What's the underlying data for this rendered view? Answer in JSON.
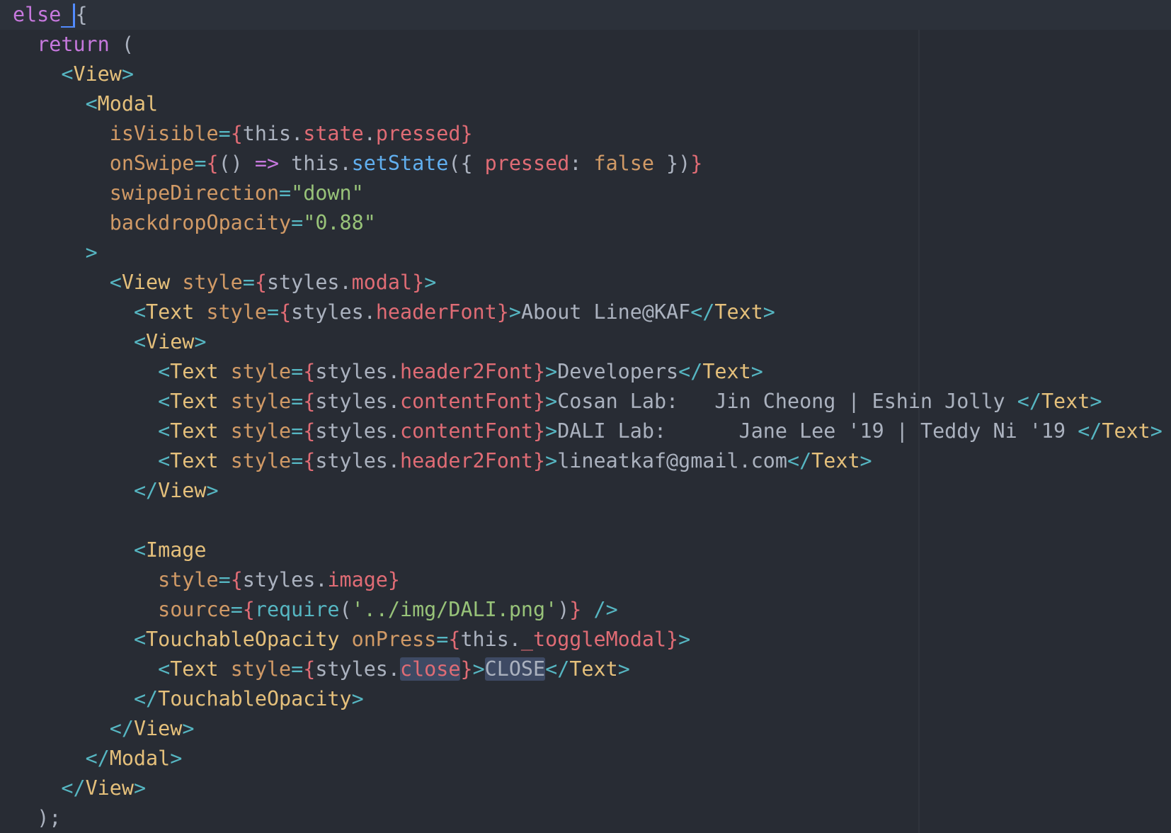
{
  "editor": {
    "cursor_line": 0,
    "highlight_tokens": [
      "close",
      "CLOSE"
    ],
    "colors": {
      "background": "#282c34",
      "cursor_line": "#2c313a",
      "keyword": "#c678dd",
      "tag": "#e5c07b",
      "bracket": "#56b6c2",
      "attribute": "#d19a66",
      "brace": "#e06c75",
      "property": "#e06c75",
      "string": "#98c379",
      "function": "#61afef",
      "text": "#abb2bf",
      "caret": "#528bff",
      "selection_highlight": "#3e4a64"
    },
    "lines": [
      {
        "indent": 0,
        "tokens": [
          [
            "keyword",
            "else"
          ],
          [
            "default",
            " "
          ],
          [
            "punct",
            "{"
          ]
        ],
        "caret_after": 2
      },
      {
        "indent": 1,
        "tokens": [
          [
            "keyword",
            "return"
          ],
          [
            "default",
            " ("
          ]
        ]
      },
      {
        "indent": 2,
        "tokens": [
          [
            "bracket",
            "<"
          ],
          [
            "tag",
            "View"
          ],
          [
            "bracket",
            ">"
          ]
        ]
      },
      {
        "indent": 3,
        "tokens": [
          [
            "bracket",
            "<"
          ],
          [
            "tag",
            "Modal"
          ]
        ]
      },
      {
        "indent": 4,
        "tokens": [
          [
            "attr",
            "isVisible"
          ],
          [
            "bracket",
            "="
          ],
          [
            "brace",
            "{"
          ],
          [
            "this",
            "this"
          ],
          [
            "punct",
            "."
          ],
          [
            "prop",
            "state"
          ],
          [
            "punct",
            "."
          ],
          [
            "prop",
            "pressed"
          ],
          [
            "brace",
            "}"
          ]
        ]
      },
      {
        "indent": 4,
        "tokens": [
          [
            "attr",
            "onSwipe"
          ],
          [
            "bracket",
            "="
          ],
          [
            "brace",
            "{"
          ],
          [
            "punct",
            "() "
          ],
          [
            "operator",
            "=>"
          ],
          [
            "default",
            " "
          ],
          [
            "this",
            "this"
          ],
          [
            "punct",
            "."
          ],
          [
            "func",
            "setState"
          ],
          [
            "punct",
            "({ "
          ],
          [
            "prop",
            "pressed"
          ],
          [
            "punct",
            ": "
          ],
          [
            "bool",
            "false"
          ],
          [
            "punct",
            " })"
          ],
          [
            "brace",
            "}"
          ]
        ]
      },
      {
        "indent": 4,
        "tokens": [
          [
            "attr",
            "swipeDirection"
          ],
          [
            "bracket",
            "="
          ],
          [
            "string",
            "\"down\""
          ]
        ]
      },
      {
        "indent": 4,
        "tokens": [
          [
            "attr",
            "backdropOpacity"
          ],
          [
            "bracket",
            "="
          ],
          [
            "string",
            "\"0.88\""
          ]
        ]
      },
      {
        "indent": 3,
        "tokens": [
          [
            "bracket",
            ">"
          ]
        ]
      },
      {
        "indent": 4,
        "tokens": [
          [
            "bracket",
            "<"
          ],
          [
            "tag",
            "View"
          ],
          [
            "default",
            " "
          ],
          [
            "attr",
            "style"
          ],
          [
            "bracket",
            "="
          ],
          [
            "brace",
            "{"
          ],
          [
            "default",
            "styles"
          ],
          [
            "punct",
            "."
          ],
          [
            "prop",
            "modal"
          ],
          [
            "brace",
            "}"
          ],
          [
            "bracket",
            ">"
          ]
        ]
      },
      {
        "indent": 5,
        "tokens": [
          [
            "bracket",
            "<"
          ],
          [
            "tag",
            "Text"
          ],
          [
            "default",
            " "
          ],
          [
            "attr",
            "style"
          ],
          [
            "bracket",
            "="
          ],
          [
            "brace",
            "{"
          ],
          [
            "default",
            "styles"
          ],
          [
            "punct",
            "."
          ],
          [
            "prop",
            "headerFont"
          ],
          [
            "brace",
            "}"
          ],
          [
            "bracket",
            ">"
          ],
          [
            "text",
            "About Line@KAF"
          ],
          [
            "bracket",
            "</"
          ],
          [
            "tag",
            "Text"
          ],
          [
            "bracket",
            ">"
          ]
        ]
      },
      {
        "indent": 5,
        "tokens": [
          [
            "bracket",
            "<"
          ],
          [
            "tag",
            "View"
          ],
          [
            "bracket",
            ">"
          ]
        ]
      },
      {
        "indent": 6,
        "tokens": [
          [
            "bracket",
            "<"
          ],
          [
            "tag",
            "Text"
          ],
          [
            "default",
            " "
          ],
          [
            "attr",
            "style"
          ],
          [
            "bracket",
            "="
          ],
          [
            "brace",
            "{"
          ],
          [
            "default",
            "styles"
          ],
          [
            "punct",
            "."
          ],
          [
            "prop",
            "header2Font"
          ],
          [
            "brace",
            "}"
          ],
          [
            "bracket",
            ">"
          ],
          [
            "text",
            "Developers"
          ],
          [
            "bracket",
            "</"
          ],
          [
            "tag",
            "Text"
          ],
          [
            "bracket",
            ">"
          ]
        ]
      },
      {
        "indent": 6,
        "tokens": [
          [
            "bracket",
            "<"
          ],
          [
            "tag",
            "Text"
          ],
          [
            "default",
            " "
          ],
          [
            "attr",
            "style"
          ],
          [
            "bracket",
            "="
          ],
          [
            "brace",
            "{"
          ],
          [
            "default",
            "styles"
          ],
          [
            "punct",
            "."
          ],
          [
            "prop",
            "contentFont"
          ],
          [
            "brace",
            "}"
          ],
          [
            "bracket",
            ">"
          ],
          [
            "text",
            "Cosan Lab:   Jin Cheong | Eshin Jolly "
          ],
          [
            "bracket",
            "</"
          ],
          [
            "tag",
            "Text"
          ],
          [
            "bracket",
            ">"
          ]
        ]
      },
      {
        "indent": 6,
        "tokens": [
          [
            "bracket",
            "<"
          ],
          [
            "tag",
            "Text"
          ],
          [
            "default",
            " "
          ],
          [
            "attr",
            "style"
          ],
          [
            "bracket",
            "="
          ],
          [
            "brace",
            "{"
          ],
          [
            "default",
            "styles"
          ],
          [
            "punct",
            "."
          ],
          [
            "prop",
            "contentFont"
          ],
          [
            "brace",
            "}"
          ],
          [
            "bracket",
            ">"
          ],
          [
            "text",
            "DALI Lab:      Jane Lee '19 | Teddy Ni '19 "
          ],
          [
            "bracket",
            "</"
          ],
          [
            "tag",
            "Text"
          ],
          [
            "bracket",
            ">"
          ]
        ]
      },
      {
        "indent": 6,
        "tokens": [
          [
            "bracket",
            "<"
          ],
          [
            "tag",
            "Text"
          ],
          [
            "default",
            " "
          ],
          [
            "attr",
            "style"
          ],
          [
            "bracket",
            "="
          ],
          [
            "brace",
            "{"
          ],
          [
            "default",
            "styles"
          ],
          [
            "punct",
            "."
          ],
          [
            "prop",
            "header2Font"
          ],
          [
            "brace",
            "}"
          ],
          [
            "bracket",
            ">"
          ],
          [
            "text",
            "lineatkaf@gmail.com"
          ],
          [
            "bracket",
            "</"
          ],
          [
            "tag",
            "Text"
          ],
          [
            "bracket",
            ">"
          ]
        ]
      },
      {
        "indent": 5,
        "tokens": [
          [
            "bracket",
            "</"
          ],
          [
            "tag",
            "View"
          ],
          [
            "bracket",
            ">"
          ]
        ]
      },
      {
        "indent": 0,
        "tokens": []
      },
      {
        "indent": 5,
        "tokens": [
          [
            "bracket",
            "<"
          ],
          [
            "tag",
            "Image"
          ]
        ]
      },
      {
        "indent": 6,
        "tokens": [
          [
            "attr",
            "style"
          ],
          [
            "bracket",
            "="
          ],
          [
            "brace",
            "{"
          ],
          [
            "default",
            "styles"
          ],
          [
            "punct",
            "."
          ],
          [
            "prop",
            "image"
          ],
          [
            "brace",
            "}"
          ]
        ]
      },
      {
        "indent": 6,
        "tokens": [
          [
            "attr",
            "source"
          ],
          [
            "bracket",
            "="
          ],
          [
            "brace",
            "{"
          ],
          [
            "builtin",
            "require"
          ],
          [
            "punct",
            "("
          ],
          [
            "string",
            "'../img/DALI.png'"
          ],
          [
            "punct",
            ")"
          ],
          [
            "brace",
            "}"
          ],
          [
            "default",
            " "
          ],
          [
            "bracket",
            "/>"
          ]
        ]
      },
      {
        "indent": 5,
        "tokens": [
          [
            "bracket",
            "<"
          ],
          [
            "tag",
            "TouchableOpacity"
          ],
          [
            "default",
            " "
          ],
          [
            "attr",
            "onPress"
          ],
          [
            "bracket",
            "="
          ],
          [
            "brace",
            "{"
          ],
          [
            "this",
            "this"
          ],
          [
            "punct",
            "."
          ],
          [
            "prop",
            "_toggleModal"
          ],
          [
            "brace",
            "}"
          ],
          [
            "bracket",
            ">"
          ]
        ]
      },
      {
        "indent": 6,
        "tokens": [
          [
            "bracket",
            "<"
          ],
          [
            "tag",
            "Text"
          ],
          [
            "default",
            " "
          ],
          [
            "attr",
            "style"
          ],
          [
            "bracket",
            "="
          ],
          [
            "brace",
            "{"
          ],
          [
            "default",
            "styles"
          ],
          [
            "punct",
            "."
          ],
          [
            "prop",
            "close"
          ],
          [
            "brace",
            "}"
          ],
          [
            "bracket",
            ">"
          ],
          [
            "text",
            "CLOSE"
          ],
          [
            "bracket",
            "</"
          ],
          [
            "tag",
            "Text"
          ],
          [
            "bracket",
            ">"
          ]
        ]
      },
      {
        "indent": 5,
        "tokens": [
          [
            "bracket",
            "</"
          ],
          [
            "tag",
            "TouchableOpacity"
          ],
          [
            "bracket",
            ">"
          ]
        ]
      },
      {
        "indent": 4,
        "tokens": [
          [
            "bracket",
            "</"
          ],
          [
            "tag",
            "View"
          ],
          [
            "bracket",
            ">"
          ]
        ]
      },
      {
        "indent": 3,
        "tokens": [
          [
            "bracket",
            "</"
          ],
          [
            "tag",
            "Modal"
          ],
          [
            "bracket",
            ">"
          ]
        ]
      },
      {
        "indent": 2,
        "tokens": [
          [
            "bracket",
            "</"
          ],
          [
            "tag",
            "View"
          ],
          [
            "bracket",
            ">"
          ]
        ]
      },
      {
        "indent": 1,
        "tokens": [
          [
            "punct",
            ");"
          ]
        ]
      }
    ]
  }
}
